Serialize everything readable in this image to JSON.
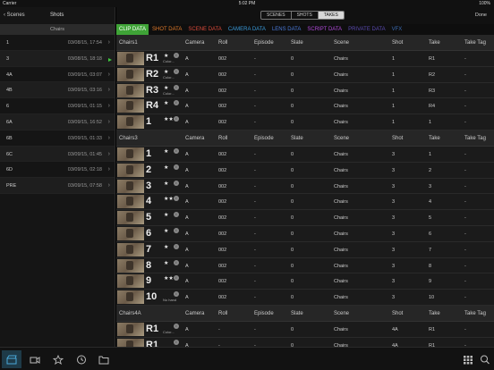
{
  "status": {
    "carrier": "Carrier",
    "time": "5:02 PM",
    "battery": "100%"
  },
  "left": {
    "back_label": "Scenes",
    "title": "Shots",
    "group_label": "Chairs",
    "rows": [
      {
        "shot": "1",
        "date": "03/08/15, 17:54"
      },
      {
        "shot": "3",
        "date": "03/08/15, 18:18",
        "active": true
      },
      {
        "shot": "4A",
        "date": "03/09/15, 03:07"
      },
      {
        "shot": "4B",
        "date": "03/09/15, 03:16"
      },
      {
        "shot": "6",
        "date": "03/09/15, 01:15"
      },
      {
        "shot": "6A",
        "date": "03/09/15, 16:52"
      },
      {
        "shot": "6B",
        "date": "03/09/15, 01:33"
      },
      {
        "shot": "6C",
        "date": "03/09/15, 01:45"
      },
      {
        "shot": "6D",
        "date": "03/09/15, 02:18"
      },
      {
        "shot": "PRE",
        "date": "03/09/15, 07:58"
      }
    ]
  },
  "segments": {
    "scenes": "SCENES",
    "shots": "SHOTS",
    "takes": "TAKES"
  },
  "done_label": "Done",
  "tabs": [
    {
      "label": "CLIP DATA",
      "color": "#ffffff"
    },
    {
      "label": "SHOT DATA",
      "color": "#e07a2a"
    },
    {
      "label": "SCENE DATA",
      "color": "#d94a3a"
    },
    {
      "label": "CAMERA DATA",
      "color": "#3a9ad9"
    },
    {
      "label": "LENS DATA",
      "color": "#4a7ad9"
    },
    {
      "label": "SCRIPT DATA",
      "color": "#b04ad9"
    },
    {
      "label": "PRIVATE DATA",
      "color": "#5a4ab0"
    },
    {
      "label": "VFX",
      "color": "#3a6ab0"
    }
  ],
  "columns": {
    "camera": "Camera",
    "roll": "Roll",
    "episode": "Episode",
    "slate": "Slate",
    "scene": "Scene",
    "shot": "Shot",
    "take": "Take",
    "tag": "Take Tag"
  },
  "groups": [
    {
      "name": "Chairs1",
      "rows": [
        {
          "take": "R1",
          "stars": "★",
          "note": "Color...",
          "camera": "A",
          "roll": "002",
          "episode": "-",
          "slate": "0",
          "scene": "Chairs",
          "shot": "1",
          "take_val": "R1",
          "tag": "-"
        },
        {
          "take": "R2",
          "stars": "★",
          "note": "Color...",
          "camera": "A",
          "roll": "002",
          "episode": "-",
          "slate": "0",
          "scene": "Chairs",
          "shot": "1",
          "take_val": "R2",
          "tag": "-"
        },
        {
          "take": "R3",
          "stars": "★",
          "note": "Color...",
          "camera": "A",
          "roll": "002",
          "episode": "-",
          "slate": "0",
          "scene": "Chairs",
          "shot": "1",
          "take_val": "R3",
          "tag": "-"
        },
        {
          "take": "R4",
          "stars": "★",
          "note": "",
          "camera": "A",
          "roll": "002",
          "episode": "-",
          "slate": "0",
          "scene": "Chairs",
          "shot": "1",
          "take_val": "R4",
          "tag": "-"
        },
        {
          "take": "1",
          "stars": "★★",
          "note": "",
          "camera": "A",
          "roll": "002",
          "episode": "-",
          "slate": "0",
          "scene": "Chairs",
          "shot": "1",
          "take_val": "1",
          "tag": "-"
        }
      ]
    },
    {
      "name": "Chairs3",
      "rows": [
        {
          "take": "1",
          "stars": "★",
          "note": "",
          "camera": "A",
          "roll": "002",
          "episode": "-",
          "slate": "0",
          "scene": "Chairs",
          "shot": "3",
          "take_val": "1",
          "tag": "-"
        },
        {
          "take": "2",
          "stars": "★",
          "note": "",
          "camera": "A",
          "roll": "002",
          "episode": "-",
          "slate": "0",
          "scene": "Chairs",
          "shot": "3",
          "take_val": "2",
          "tag": "-"
        },
        {
          "take": "3",
          "stars": "★",
          "note": "",
          "camera": "A",
          "roll": "002",
          "episode": "-",
          "slate": "0",
          "scene": "Chairs",
          "shot": "3",
          "take_val": "3",
          "tag": "-"
        },
        {
          "take": "4",
          "stars": "★★",
          "note": "",
          "camera": "A",
          "roll": "002",
          "episode": "-",
          "slate": "0",
          "scene": "Chairs",
          "shot": "3",
          "take_val": "4",
          "tag": "-"
        },
        {
          "take": "5",
          "stars": "★",
          "note": "",
          "camera": "A",
          "roll": "002",
          "episode": "-",
          "slate": "0",
          "scene": "Chairs",
          "shot": "3",
          "take_val": "5",
          "tag": "-"
        },
        {
          "take": "6",
          "stars": "★",
          "note": "",
          "camera": "A",
          "roll": "002",
          "episode": "-",
          "slate": "0",
          "scene": "Chairs",
          "shot": "3",
          "take_val": "6",
          "tag": "-"
        },
        {
          "take": "7",
          "stars": "★",
          "note": "",
          "camera": "A",
          "roll": "002",
          "episode": "-",
          "slate": "0",
          "scene": "Chairs",
          "shot": "3",
          "take_val": "7",
          "tag": "-"
        },
        {
          "take": "8",
          "stars": "★",
          "note": "",
          "camera": "A",
          "roll": "002",
          "episode": "-",
          "slate": "0",
          "scene": "Chairs",
          "shot": "3",
          "take_val": "8",
          "tag": "-"
        },
        {
          "take": "9",
          "stars": "★★★",
          "note": "",
          "camera": "A",
          "roll": "002",
          "episode": "-",
          "slate": "0",
          "scene": "Chairs",
          "shot": "3",
          "take_val": "9",
          "tag": "-"
        },
        {
          "take": "10",
          "stars": "",
          "note": "No hand",
          "camera": "A",
          "roll": "002",
          "episode": "-",
          "slate": "0",
          "scene": "Chairs",
          "shot": "3",
          "take_val": "10",
          "tag": "-"
        }
      ]
    },
    {
      "name": "Chairs4A",
      "rows": [
        {
          "take": "R1",
          "stars": "",
          "note": "Color...",
          "camera": "A",
          "roll": "-",
          "episode": "-",
          "slate": "0",
          "scene": "Chairs",
          "shot": "4A",
          "take_val": "R1",
          "tag": "-"
        },
        {
          "take": "R1",
          "stars": "",
          "note": "Color...",
          "camera": "A",
          "roll": "-",
          "episode": "-",
          "slate": "0",
          "scene": "Chairs",
          "shot": "4A",
          "take_val": "R1",
          "tag": "-"
        }
      ]
    }
  ]
}
